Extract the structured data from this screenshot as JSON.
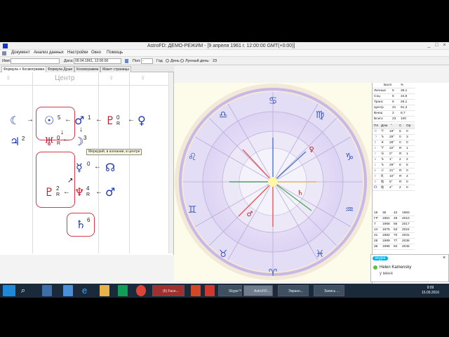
{
  "window": {
    "title": "AstroFD: ДЕМО-РЕЖИМ - [9 апреля 1961 г. 12:00:00 GMT(+0:00)]",
    "minimize": "_",
    "maximize": "□",
    "close": "×"
  },
  "menu": [
    "Документ",
    "Анализ данных",
    "Настройки",
    "Окно",
    "Помощь"
  ],
  "toolbar": {
    "name_label": "Имя:",
    "name_value": "",
    "date_label": "Дата:",
    "date_value": "09.04.1961, 12:00:00",
    "sex_label": "Пол:",
    "sex_value": "-",
    "year_label": "Год",
    "day_label": "День",
    "lunar_label": "Лунный день:",
    "lunar_value": "23"
  },
  "tabs": [
    "Формула + Космограмма",
    "Формула Души",
    "Космограмма",
    "Макет страницы"
  ],
  "formula": {
    "center_heading": "Центр",
    "left_heading": "♀",
    "right_heading": "♀",
    "tooltip": "Меркурий, в изгнании, в центре",
    "glyphs": {
      "moon": "☾",
      "sun": "☉",
      "sun_num": "5",
      "mars": "♂",
      "mars_num": "1",
      "pluto_r": "♇",
      "pluto_num": "0",
      "R": "R",
      "venus": "♀",
      "jupiter": "♃",
      "jupiter_num": "2",
      "uranus": "♅",
      "uranus_num": "0",
      "moon2": "☽",
      "moon2_num": "3",
      "mercury": "☿",
      "mercury_num": "0",
      "node": "☊",
      "pluto2": "♇",
      "pluto2_num": "2",
      "neptune": "♆",
      "neptune_num": "4",
      "mars2": "♂",
      "saturn": "♄",
      "saturn_num": "6"
    }
  },
  "sidebar": {
    "header": [
      "Балл",
      "%"
    ],
    "rows": [
      [
        "Личные",
        "5",
        "39,1"
      ],
      [
        "Соц",
        "6",
        "34,8"
      ],
      [
        "Транс",
        "6",
        "26,1"
      ],
      [
        "Центр",
        "21",
        "91,3"
      ],
      [
        "Внеш",
        "2",
        "8,7"
      ],
      [
        "Всего",
        "23",
        "100"
      ]
    ],
    "table_header": [
      "Пл",
      "Дом",
      "°",
      "С",
      "Ор"
    ],
    "planets": [
      [
        "☉",
        "♈",
        "19°",
        "5",
        "0"
      ],
      [
        "☽",
        "♑",
        "29°",
        "0",
        "3"
      ],
      [
        "☿",
        "♓",
        "28°",
        "0",
        "0"
      ],
      [
        "♀",
        "♈",
        "22°",
        "R",
        "1"
      ],
      [
        "♂",
        "♋",
        "0°",
        "R",
        "1"
      ],
      [
        "♃",
        "♑",
        "1°",
        "2",
        "2"
      ],
      [
        "♄",
        "♑",
        "29°",
        "6",
        "5"
      ],
      [
        "♅",
        "♌",
        "21°",
        "R",
        "0"
      ],
      [
        "♆",
        "♏",
        "10°",
        "R",
        "4"
      ],
      [
        "♇",
        "♍",
        "5°",
        "R",
        "0"
      ],
      [
        "☊",
        "♍",
        "4°",
        "2",
        "0"
      ]
    ],
    "years": [
      [
        "19",
        "35",
        "42",
        "1983"
      ],
      [
        "ГР",
        "1961",
        "49",
        "2010"
      ],
      [
        "7",
        "1968",
        "56",
        "2017"
      ],
      [
        "14",
        "1975",
        "63",
        "2024"
      ],
      [
        "21",
        "1982",
        "70",
        "2031"
      ],
      [
        "28",
        "1989",
        "77",
        "2038"
      ],
      [
        "35",
        "1996",
        "84",
        "2045"
      ]
    ]
  },
  "skype": {
    "brand": "skype",
    "name": "Helen Kamensky",
    "message": "у меня"
  },
  "taskbar": {
    "items": [
      "(6) Face...",
      "Skype™ -...",
      "AstroFD:...",
      "Экранн...",
      "Запись ..."
    ],
    "time": "9:09",
    "date": "15.09.2016"
  },
  "colors": {
    "accent_red": "#c21b2a",
    "accent_blue": "#1a35b8",
    "taskbar": "#1b2a3a"
  }
}
